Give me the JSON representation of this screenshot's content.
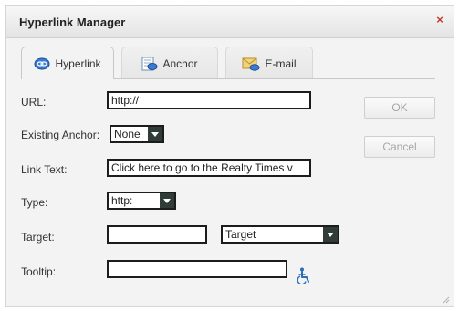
{
  "dialog": {
    "title": "Hyperlink Manager",
    "close_glyph": "×"
  },
  "tabs": [
    {
      "label": "Hyperlink",
      "icon": "hyperlink-icon",
      "active": true
    },
    {
      "label": "Anchor",
      "icon": "anchor-icon",
      "active": false
    },
    {
      "label": "E-mail",
      "icon": "email-icon",
      "active": false
    }
  ],
  "form": {
    "url": {
      "label": "URL:",
      "value": "http://"
    },
    "existing_anchor": {
      "label": "Existing Anchor:",
      "value": "None"
    },
    "link_text": {
      "label": "Link Text:",
      "value": "Click here to go to the Realty Times v"
    },
    "type": {
      "label": "Type:",
      "value": "http:"
    },
    "target": {
      "label": "Target:",
      "value": "",
      "select_value": "Target"
    },
    "tooltip": {
      "label": "Tooltip:",
      "value": "",
      "icon": "accessibility-icon"
    }
  },
  "buttons": {
    "ok": "OK",
    "cancel": "Cancel"
  },
  "colors": {
    "close": "#c0392b",
    "select_arrow_bg": "#2f3c37",
    "accessibility_icon": "#2a6fb8",
    "disabled_button_text": "#a6a6a6"
  }
}
